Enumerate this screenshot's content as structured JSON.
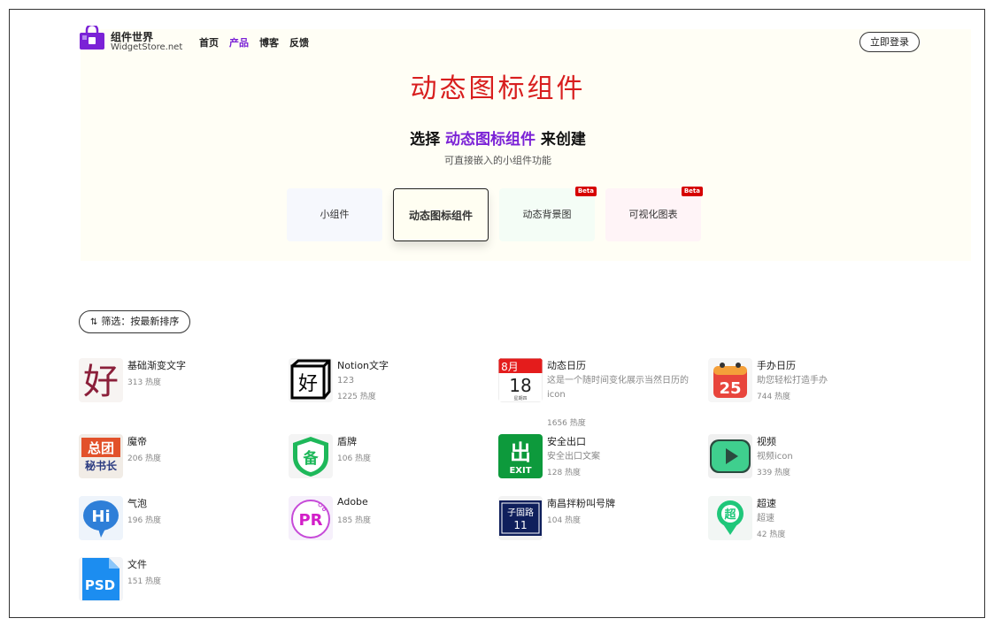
{
  "header": {
    "logo_name": "组件世界",
    "logo_sub": "WidgetStore.net",
    "nav": [
      "首页",
      "产品",
      "博客",
      "反馈"
    ],
    "login": "立即登录"
  },
  "hero": {
    "title": "动态图标组件",
    "subtitle_prefix": "选择",
    "subtitle_highlight": "动态图标组件",
    "subtitle_suffix": "来创建",
    "desc": "可直接嵌入的小组件功能"
  },
  "tabs": [
    {
      "label": "小组件",
      "badge": ""
    },
    {
      "label": "动态图标组件",
      "badge": ""
    },
    {
      "label": "动态背景图",
      "badge": "Beta"
    },
    {
      "label": "可视化图表",
      "badge": "Beta"
    }
  ],
  "filter": {
    "icon": "⇅",
    "label": "筛选：",
    "value": "按最新排序"
  },
  "items": [
    {
      "name": "基础渐变文字",
      "desc": "",
      "heat": "313 热度",
      "icon": "hao-text-icon"
    },
    {
      "name": "Notion文字",
      "desc": "123",
      "heat": "1225 热度",
      "icon": "notion-text-icon"
    },
    {
      "name": "动态日历",
      "desc": "这是一个随时间变化展示当然日历的icon",
      "heat": "1656 热度",
      "icon": "calendar-icon"
    },
    {
      "name": "手办日历",
      "desc": "助您轻松打造手办",
      "heat": "744 热度",
      "icon": "figure-calendar-icon"
    },
    {
      "name": "魔帝",
      "desc": "",
      "heat": "206 热度",
      "icon": "modi-icon"
    },
    {
      "name": "盾牌",
      "desc": "",
      "heat": "106 热度",
      "icon": "shield-icon"
    },
    {
      "name": "安全出口",
      "desc": "安全出口文案",
      "heat": "128 热度",
      "icon": "exit-icon"
    },
    {
      "name": "视频",
      "desc": "视频icon",
      "heat": "339 热度",
      "icon": "video-icon"
    },
    {
      "name": "气泡",
      "desc": "",
      "heat": "196 热度",
      "icon": "bubble-icon"
    },
    {
      "name": "Adobe",
      "desc": "",
      "heat": "185 热度",
      "icon": "adobe-icon"
    },
    {
      "name": "南昌拌粉叫号牌",
      "desc": "",
      "heat": "104 热度",
      "icon": "queue-sign-icon"
    },
    {
      "name": "超速",
      "desc": "超速",
      "heat": "42 热度",
      "icon": "speed-icon"
    },
    {
      "name": "文件",
      "desc": "",
      "heat": "151 热度",
      "icon": "psd-file-icon"
    }
  ],
  "icon_text": {
    "hao": "好",
    "cal_month": "8月",
    "cal_day": "18",
    "cal_week": "星期四",
    "fig_day": "25",
    "modi_top": "总团",
    "modi_bottom": "秘书长",
    "shield_char": "备",
    "exit_char": "出",
    "exit_word": "EXIT",
    "bubble": "Hi",
    "adobe": "PR",
    "queue_top": "子固路",
    "queue_num": "11",
    "speed_char": "超",
    "psd": "PSD"
  },
  "colors": {
    "accent": "#7b22d6",
    "title_red": "#d81e1e",
    "beta_red": "#d60000"
  }
}
